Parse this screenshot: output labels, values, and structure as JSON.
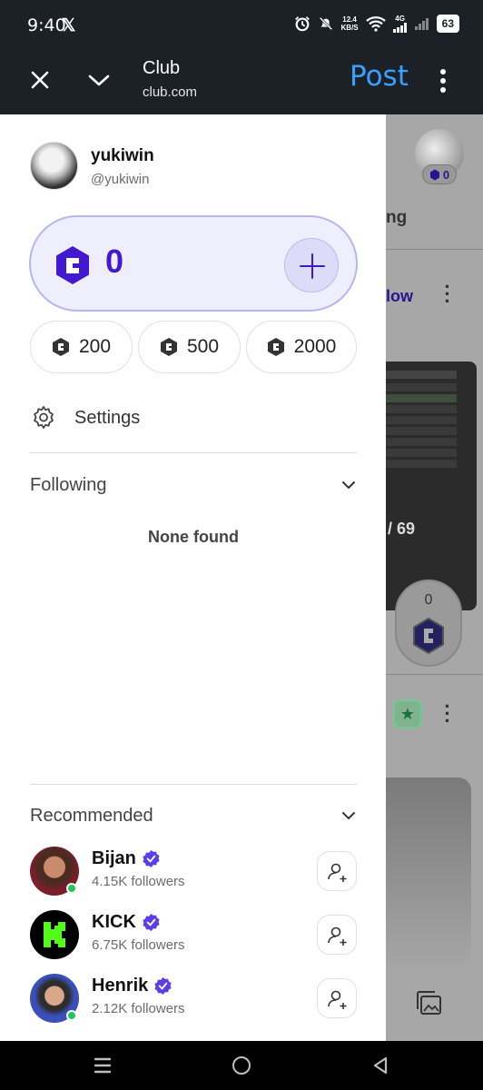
{
  "status_bar": {
    "time": "9:40",
    "app_icon": "x-logo",
    "speed_value": "12.4",
    "speed_unit": "KB/S",
    "network": "4G",
    "battery": "63",
    "icons": [
      "alarm-icon",
      "mute-icon",
      "wifi-icon",
      "signal-icon",
      "battery-icon"
    ]
  },
  "browser": {
    "site_title": "Club",
    "site_url": "club.com",
    "post_label": "Post",
    "post_color": "#3aa0ff"
  },
  "profile": {
    "name": "yukiwin",
    "handle": "@yukiwin"
  },
  "balance": {
    "amount": "0",
    "accent": "#4318d1"
  },
  "coin_options": [
    {
      "label": "200"
    },
    {
      "label": "500"
    },
    {
      "label": "2000"
    }
  ],
  "settings": {
    "label": "Settings"
  },
  "following": {
    "title": "Following",
    "empty_text": "None found"
  },
  "recommended": {
    "title": "Recommended",
    "items": [
      {
        "name": "Bijan",
        "followers": "4.15K followers",
        "online": true
      },
      {
        "name": "KICK",
        "followers": "6.75K followers",
        "online": false
      },
      {
        "name": "Henrik",
        "followers": "2.12K followers",
        "online": true
      }
    ]
  },
  "background_page": {
    "badge_count": "0",
    "partial_tab": "ng",
    "partial_follow": "low",
    "coin_count": "0",
    "score": "/ 69"
  }
}
